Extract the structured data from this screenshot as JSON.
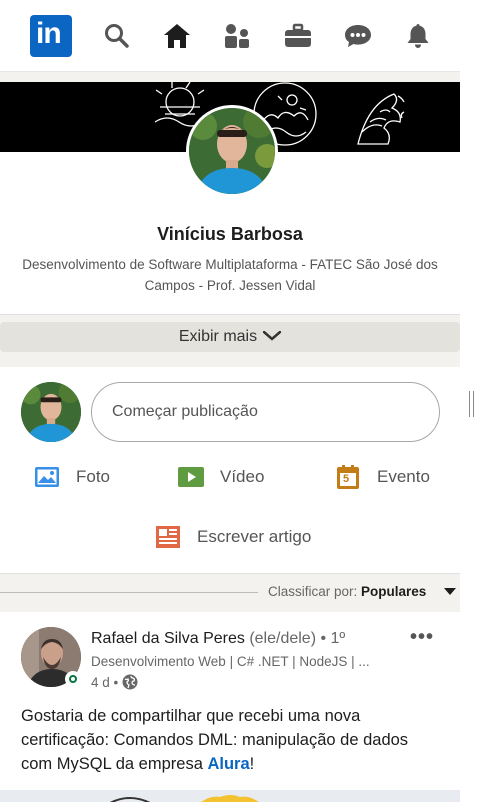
{
  "nav": {
    "logo_text": "in",
    "icons": [
      "linkedin-logo",
      "search-icon",
      "home-icon",
      "network-icon",
      "jobs-icon",
      "messaging-icon",
      "notifications-icon"
    ]
  },
  "profile": {
    "name": "Vinícius Barbosa",
    "headline": "Desenvolvimento de Software Multiplataforma - FATEC São José dos Campos - Prof. Jessen Vidal",
    "show_more": "Exibir mais"
  },
  "composer": {
    "placeholder": "Começar publicação",
    "actions": {
      "photo": "Foto",
      "video": "Vídeo",
      "event": "Evento",
      "article": "Escrever artigo"
    },
    "event_day": "5"
  },
  "feed": {
    "sort_label": "Classificar por:",
    "sort_value": "Populares",
    "post": {
      "author": "Rafael da Silva Peres",
      "pronouns": "(ele/dele)",
      "degree": "• 1º",
      "subtitle": "Desenvolvimento Web | C# .NET | NodeJS | ...",
      "time": "4 d •",
      "text_before": "Gostaria de compartilhar que recebi uma nova certificação: Comandos DML: manipulação de dados com MySQL da empresa ",
      "text_link": "Alura",
      "text_after": "!",
      "more_label": "•••"
    }
  },
  "colors": {
    "brand": "#0a66c2",
    "photo": "#378fe9",
    "video": "#5f9b41",
    "event": "#c37d16",
    "article": "#e16745"
  }
}
